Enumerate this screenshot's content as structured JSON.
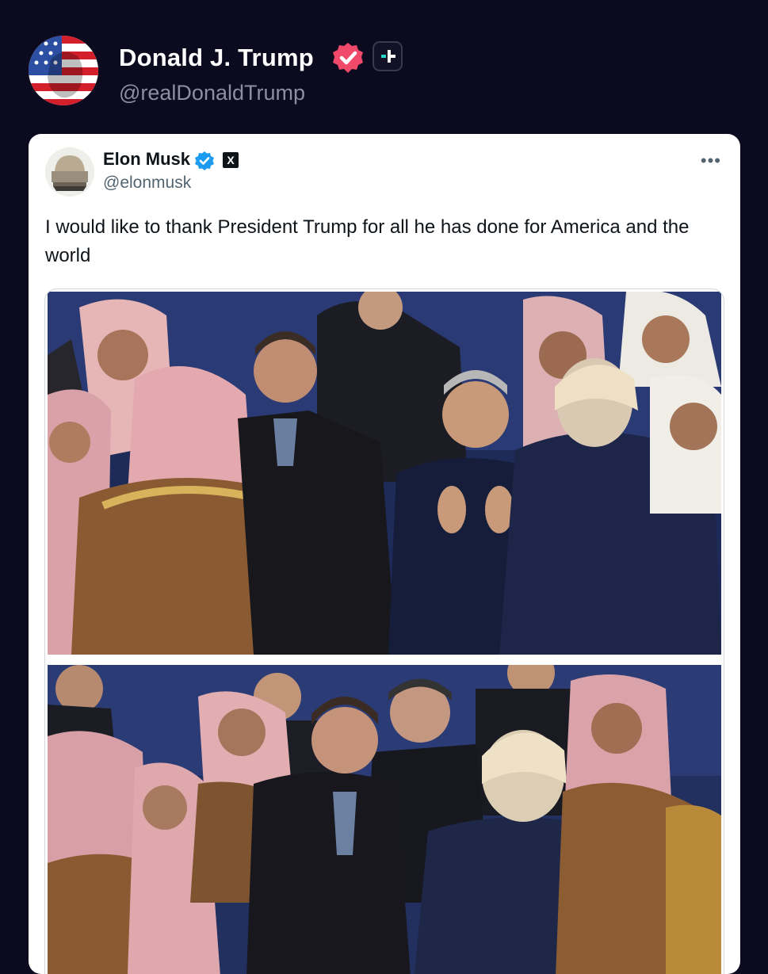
{
  "post": {
    "display_name": "Donald J. Trump",
    "handle": "@realDonaldTrump",
    "avatar_icon": "flag-face-avatar-icon",
    "badges": [
      "verified-badge-icon",
      "plus-badge-icon"
    ],
    "colors": {
      "background": "#0b0a1e",
      "verified": "#f04969",
      "handle": "#8e8da3"
    }
  },
  "quoted_post": {
    "display_name": "Elon Musk",
    "handle": "@elonmusk",
    "text": "I would like to thank President Trump for all he has done for America and the world",
    "badges": [
      "verified-badge-icon",
      "x-badge-icon"
    ],
    "x_badge_label": "X",
    "more_icon": "more-options-icon",
    "more_label": "•••",
    "colors": {
      "verified": "#1d9bf0",
      "text": "#0f1419",
      "handle": "#536471"
    },
    "media": [
      {
        "kind": "photo",
        "subject": "group-photo-1"
      },
      {
        "kind": "photo",
        "subject": "group-photo-2"
      }
    ]
  }
}
